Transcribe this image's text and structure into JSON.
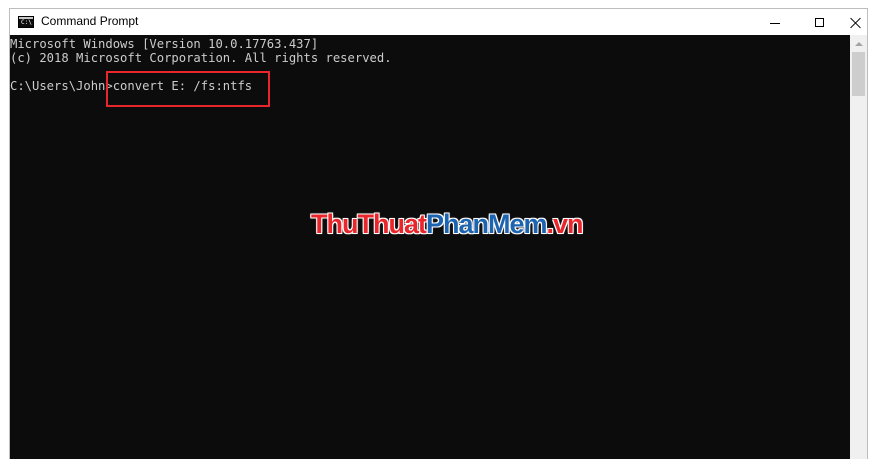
{
  "window": {
    "title": "Command Prompt",
    "icon": "cmd-icon",
    "icon_text": "C:\\"
  },
  "console": {
    "lines": [
      "Microsoft Windows [Version 10.0.17763.437]",
      "(c) 2018 Microsoft Corporation. All rights reserved.",
      "",
      "C:\\Users\\John>convert E: /fs:ntfs"
    ],
    "highlight_color": "#e8262b",
    "text_color": "#cccccc",
    "background": "#0c0c0c"
  },
  "watermark": {
    "part1": "ThuThuat",
    "part2": "PhanMem",
    "part3": ".vn",
    "colors": {
      "red": "#e8262b",
      "blue": "#1d64b0"
    }
  },
  "controls": {
    "minimize_icon": "minimize-icon",
    "maximize_icon": "maximize-icon",
    "close_icon": "close-icon"
  }
}
